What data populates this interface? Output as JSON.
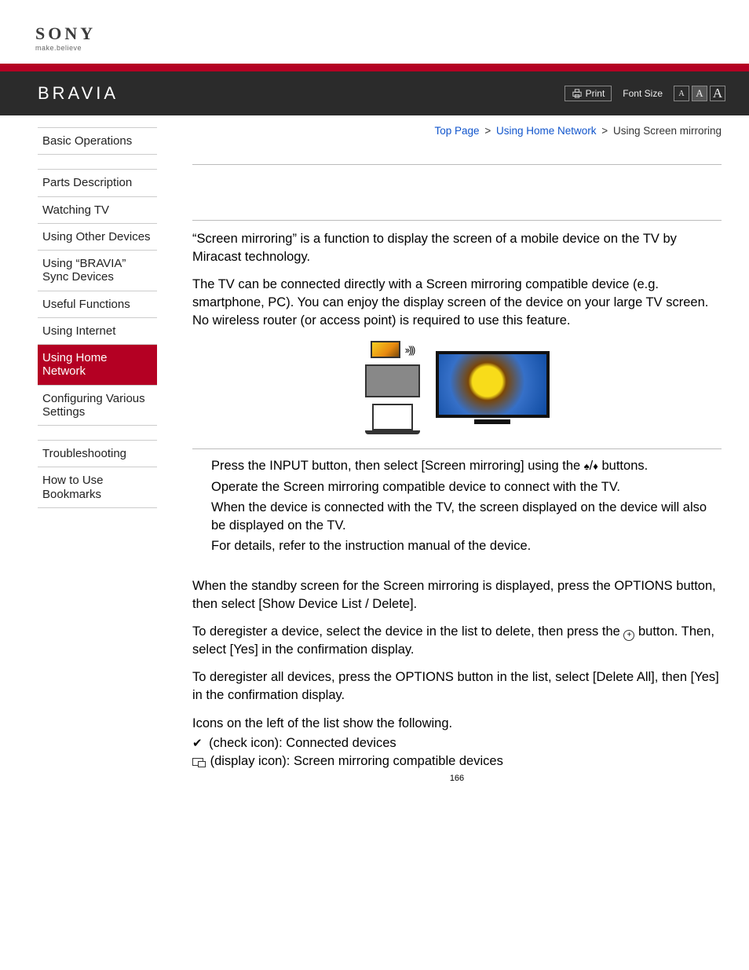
{
  "logo": {
    "brand": "SONY",
    "tagline": "make.believe"
  },
  "header": {
    "product": "BRAVIA",
    "print_label": "Print",
    "font_size_label": "Font Size",
    "font_sm": "A",
    "font_md": "A",
    "font_lg": "A"
  },
  "nav": {
    "group1": [
      "Basic Operations"
    ],
    "group2": [
      "Parts Description",
      "Watching TV",
      "Using Other Devices",
      "Using “BRAVIA” Sync Devices",
      "Useful Functions",
      "Using Internet",
      "Using Home Network",
      "Configuring Various Settings"
    ],
    "group3": [
      "Troubleshooting",
      "How to Use Bookmarks"
    ],
    "active": "Using Home Network"
  },
  "breadcrumb": {
    "top": "Top Page",
    "mid": "Using Home Network",
    "cur": "Using Screen mirroring",
    "sep": ">"
  },
  "content": {
    "intro1": "“Screen mirroring” is a function to display the screen of a mobile device on the TV by Miracast technology.",
    "intro2": "The TV can be connected directly with a Screen mirroring compatible device (e.g. smartphone, PC). You can enjoy the display screen of the device on your large TV screen. No wireless router (or access point) is required to use this feature.",
    "step1a": "Press the INPUT button, then select [Screen mirroring] using the ",
    "step1b": " buttons.",
    "step2": "Operate the Screen mirroring compatible device to connect with the TV.",
    "step3": "When the device is connected with the TV, the screen displayed on the device will also be displayed on the TV.",
    "step4": "For details, refer to the instruction manual of the device.",
    "p1": "When the standby screen for the Screen mirroring is displayed, press the OPTIONS button, then select [Show Device List / Delete].",
    "p2a": "To deregister a device, select the device in the list to delete, then press the ",
    "p2b": " button. Then, select [Yes] in the confirmation display.",
    "p3": "To deregister all devices, press the OPTIONS button in the list, select [Delete All], then [Yes] in the confirmation display.",
    "p4": "Icons on the left of the list show the following.",
    "icon_check": " (check icon): Connected devices",
    "icon_display": " (display icon): Screen mirroring compatible devices",
    "radio": "››)))"
  },
  "page_number": "166"
}
